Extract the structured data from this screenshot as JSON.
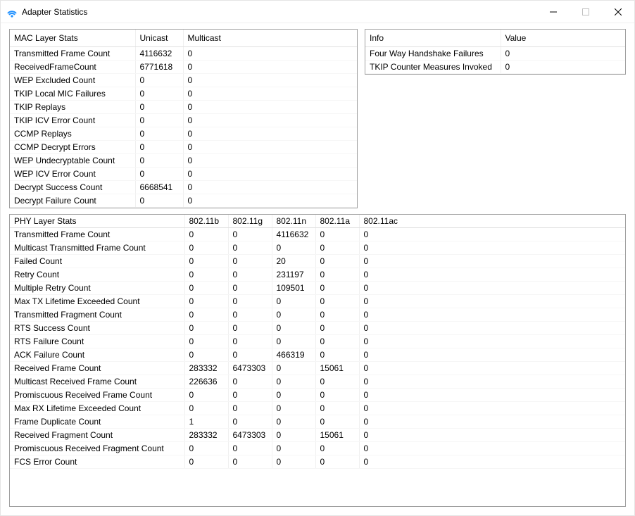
{
  "window": {
    "title": "Adapter Statistics"
  },
  "mac": {
    "headers": [
      "MAC Layer Stats",
      "Unicast",
      "Multicast"
    ],
    "rows": [
      {
        "label": "Transmitted Frame Count",
        "unicast": "4116632",
        "multicast": "0"
      },
      {
        "label": "ReceivedFrameCount",
        "unicast": "6771618",
        "multicast": "0"
      },
      {
        "label": "WEP Excluded Count",
        "unicast": "0",
        "multicast": "0"
      },
      {
        "label": "TKIP Local MIC Failures",
        "unicast": "0",
        "multicast": "0"
      },
      {
        "label": "TKIP Replays",
        "unicast": "0",
        "multicast": "0"
      },
      {
        "label": "TKIP ICV Error Count",
        "unicast": "0",
        "multicast": "0"
      },
      {
        "label": "CCMP Replays",
        "unicast": "0",
        "multicast": "0"
      },
      {
        "label": "CCMP Decrypt Errors",
        "unicast": "0",
        "multicast": "0"
      },
      {
        "label": "WEP Undecryptable Count",
        "unicast": "0",
        "multicast": "0"
      },
      {
        "label": "WEP ICV Error Count",
        "unicast": "0",
        "multicast": "0"
      },
      {
        "label": "Decrypt Success Count",
        "unicast": "6668541",
        "multicast": "0"
      },
      {
        "label": "Decrypt Failure Count",
        "unicast": "0",
        "multicast": "0"
      }
    ]
  },
  "info": {
    "headers": [
      "Info",
      "Value"
    ],
    "rows": [
      {
        "label": "Four Way Handshake Failures",
        "value": "0"
      },
      {
        "label": "TKIP Counter Measures Invoked",
        "value": "0"
      }
    ]
  },
  "phy": {
    "headers": [
      "PHY Layer Stats",
      "802.11b",
      "802.11g",
      "802.11n",
      "802.11a",
      "802.11ac"
    ],
    "rows": [
      {
        "label": "Transmitted Frame Count",
        "v": [
          "0",
          "0",
          "4116632",
          "0",
          "0"
        ]
      },
      {
        "label": "Multicast Transmitted Frame Count",
        "v": [
          "0",
          "0",
          "0",
          "0",
          "0"
        ]
      },
      {
        "label": "Failed Count",
        "v": [
          "0",
          "0",
          "20",
          "0",
          "0"
        ]
      },
      {
        "label": "Retry Count",
        "v": [
          "0",
          "0",
          "231197",
          "0",
          "0"
        ]
      },
      {
        "label": "Multiple Retry Count",
        "v": [
          "0",
          "0",
          "109501",
          "0",
          "0"
        ]
      },
      {
        "label": "Max TX Lifetime Exceeded Count",
        "v": [
          "0",
          "0",
          "0",
          "0",
          "0"
        ]
      },
      {
        "label": "Transmitted Fragment Count",
        "v": [
          "0",
          "0",
          "0",
          "0",
          "0"
        ]
      },
      {
        "label": "RTS Success Count",
        "v": [
          "0",
          "0",
          "0",
          "0",
          "0"
        ]
      },
      {
        "label": "RTS Failure Count",
        "v": [
          "0",
          "0",
          "0",
          "0",
          "0"
        ]
      },
      {
        "label": "ACK Failure Count",
        "v": [
          "0",
          "0",
          "466319",
          "0",
          "0"
        ]
      },
      {
        "label": "Received Frame Count",
        "v": [
          "283332",
          "6473303",
          "0",
          "15061",
          "0"
        ]
      },
      {
        "label": "Multicast Received Frame Count",
        "v": [
          "226636",
          "0",
          "0",
          "0",
          "0"
        ]
      },
      {
        "label": "Promiscuous Received Frame Count",
        "v": [
          "0",
          "0",
          "0",
          "0",
          "0"
        ]
      },
      {
        "label": "Max RX Lifetime Exceeded Count",
        "v": [
          "0",
          "0",
          "0",
          "0",
          "0"
        ]
      },
      {
        "label": "Frame Duplicate Count",
        "v": [
          "1",
          "0",
          "0",
          "0",
          "0"
        ]
      },
      {
        "label": "Received Fragment Count",
        "v": [
          "283332",
          "6473303",
          "0",
          "15061",
          "0"
        ]
      },
      {
        "label": "Promiscuous Received Fragment Count",
        "v": [
          "0",
          "0",
          "0",
          "0",
          "0"
        ]
      },
      {
        "label": "FCS Error Count",
        "v": [
          "0",
          "0",
          "0",
          "0",
          "0"
        ]
      }
    ]
  }
}
